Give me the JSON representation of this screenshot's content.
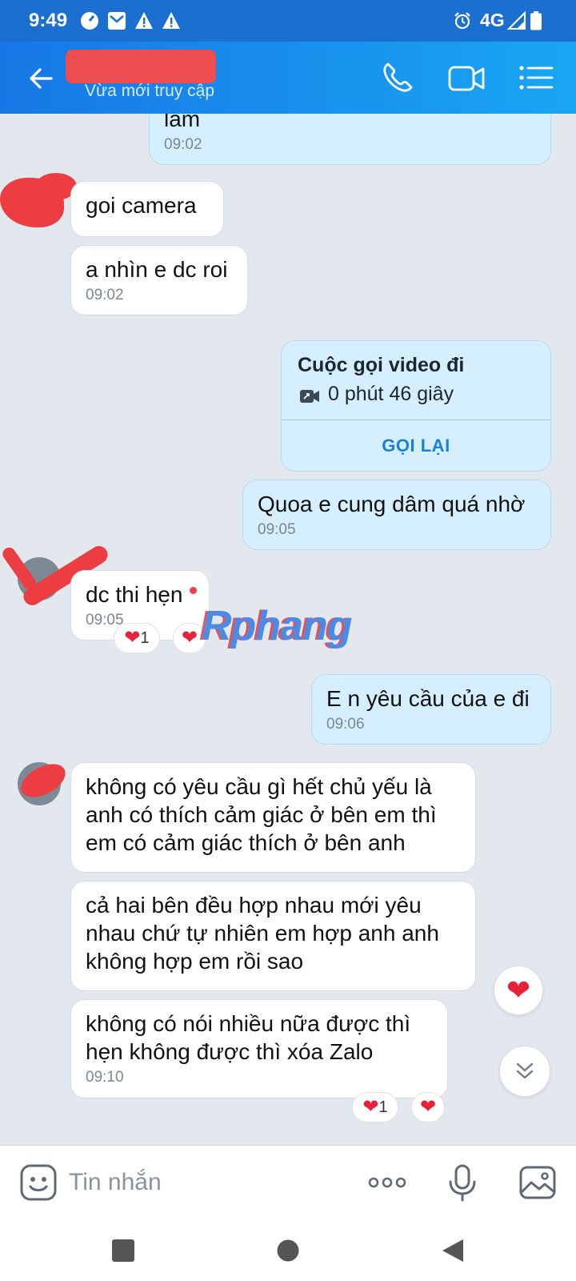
{
  "status_bar": {
    "time": "9:49",
    "network": "4G"
  },
  "header": {
    "status": "Vừa mới truy cập"
  },
  "messages": {
    "m0": {
      "text": "lâm",
      "time": "09:02"
    },
    "m1": {
      "text": "goi camera"
    },
    "m2": {
      "text": "a nhìn e dc roi",
      "time": "09:02"
    },
    "call": {
      "title": "Cuộc gọi video đi",
      "duration": "0 phút 46 giây",
      "callback_label": "GỌI LẠI"
    },
    "m3": {
      "text": "Quoa e cung dâm quá nhờ",
      "time": "09:05"
    },
    "m4": {
      "text": "dc thi hẹn",
      "time": "09:05",
      "reaction_count": "1"
    },
    "m5": {
      "text": "E n yêu cầu của e đi",
      "time": "09:06"
    },
    "m6": {
      "text": "không có yêu cầu gì hết chủ yếu là anh có thích cảm giác ở bên em thì em có cảm giác thích ở bên anh"
    },
    "m7": {
      "text": "cả hai bên đều hợp nhau mới yêu nhau chứ tự nhiên em hợp anh anh không hợp em rồi sao"
    },
    "m8": {
      "text": "không có nói nhiều nữa được thì hẹn không được thì xóa Zalo",
      "time": "09:10",
      "reaction_count": "1"
    }
  },
  "watermark": "Rphang",
  "input": {
    "placeholder": "Tin nhắn"
  },
  "colors": {
    "header": "#1a8cf0",
    "outgoing_bubble": "#d6efff",
    "incoming_bubble": "#ffffff",
    "heart": "#e8213a"
  }
}
